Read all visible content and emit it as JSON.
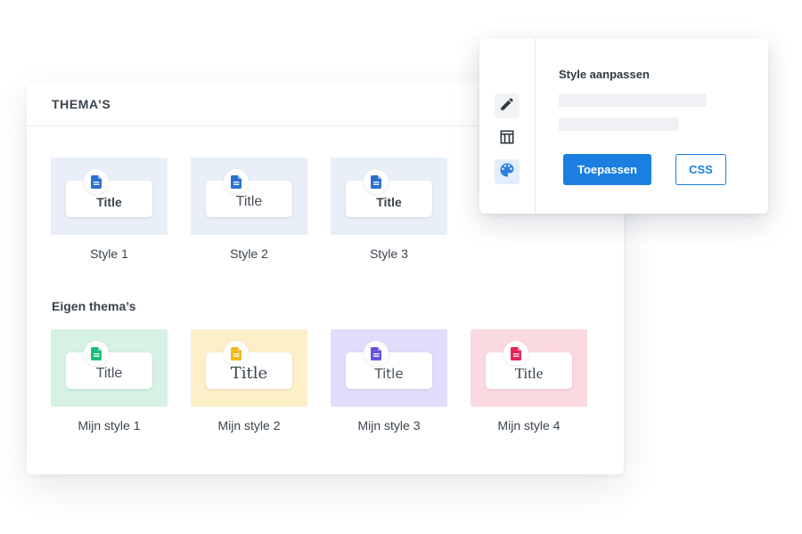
{
  "panel": {
    "title": "THEMA’S",
    "custom_section_label": "Eigen thema’s"
  },
  "default_styles": [
    {
      "title": "Title",
      "caption": "Style 1",
      "bg": "#e9eff8",
      "icon_color": "#2a6fd1",
      "variant": "t-bold"
    },
    {
      "title": "Title",
      "caption": "Style 2",
      "bg": "#e9eff8",
      "icon_color": "#2a6fd1",
      "variant": "t-light"
    },
    {
      "title": "Title",
      "caption": "Style 3",
      "bg": "#e9eff8",
      "icon_color": "#2a6fd1",
      "variant": "t-bold"
    }
  ],
  "custom_styles": [
    {
      "title": "Title",
      "caption": "Mijn style 1",
      "bg": "#d5f2e4",
      "icon_color": "#1dbf7a",
      "variant": "t-plain"
    },
    {
      "title": "Title",
      "caption": "Mijn style 2",
      "bg": "#fdf0c8",
      "icon_color": "#f2b81c",
      "variant": "t-serif"
    },
    {
      "title": "Title",
      "caption": "Mijn style 3",
      "bg": "#e0defa",
      "icon_color": "#6655dd",
      "variant": "t-thin"
    },
    {
      "title": "Title",
      "caption": "Mijn style 4",
      "bg": "#fbd9e0",
      "icon_color": "#e5245a",
      "variant": "t-serif2"
    }
  ],
  "popup": {
    "title": "Style aanpassen",
    "apply_label": "Toepassen",
    "css_label": "CSS",
    "tools": [
      {
        "icon": "pencil-icon",
        "state": "neutral"
      },
      {
        "icon": "table-icon",
        "state": "none"
      },
      {
        "icon": "palette-icon",
        "state": "active"
      }
    ]
  },
  "colors": {
    "accent": "#1a7fe0",
    "icon_dark": "#2f3a45",
    "palette_icon": "#2a7fe0"
  }
}
